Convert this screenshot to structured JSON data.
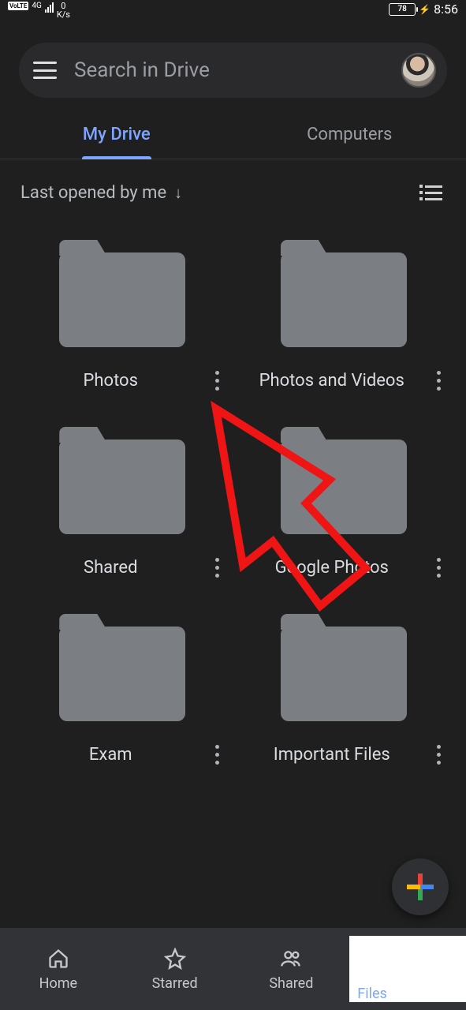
{
  "status": {
    "volte": "VoLTE",
    "net_gen": "4G",
    "speed_top": "0",
    "speed_unit": "K/s",
    "battery_pct": "78",
    "time": "8:56"
  },
  "search": {
    "placeholder": "Search in Drive"
  },
  "tabs": {
    "my_drive": "My Drive",
    "computers": "Computers"
  },
  "sort": {
    "label": "Last opened by me"
  },
  "folders": [
    {
      "name": "Photos"
    },
    {
      "name": "Photos and Videos"
    },
    {
      "name": "Shared"
    },
    {
      "name": "Google Photos"
    },
    {
      "name": "Exam"
    },
    {
      "name": "Important Files"
    }
  ],
  "nav": {
    "home": "Home",
    "starred": "Starred",
    "shared": "Shared",
    "files": "Files"
  }
}
